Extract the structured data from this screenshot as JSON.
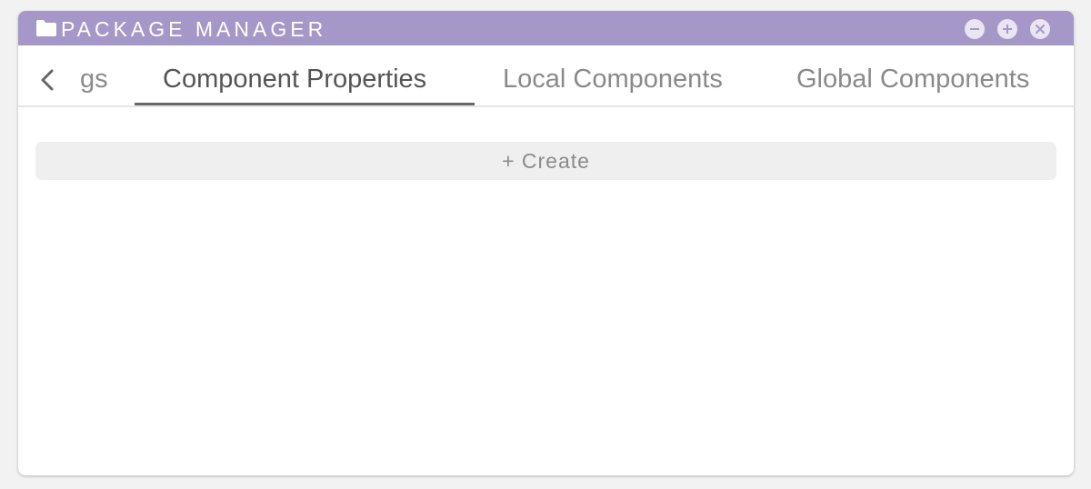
{
  "window": {
    "title": "PACKAGE MANAGER"
  },
  "tabs": [
    {
      "label": "Settings",
      "visible_label": "gs",
      "active": false
    },
    {
      "label": "Component Properties",
      "active": true
    },
    {
      "label": "Local Components",
      "active": false
    },
    {
      "label": "Global Components",
      "active": false
    }
  ],
  "main": {
    "create_label": "+ Create"
  },
  "colors": {
    "titlebar": "#a598c8",
    "title_text": "#ffffff",
    "active_tab_text": "#555555",
    "inactive_tab_text": "#8a8a8a",
    "create_button_bg": "#efefef"
  },
  "icons": {
    "folder": "folder-icon",
    "minimize": "minus-circle-icon",
    "maximize": "plus-circle-icon",
    "close": "x-circle-icon",
    "back": "chevron-left-icon"
  }
}
